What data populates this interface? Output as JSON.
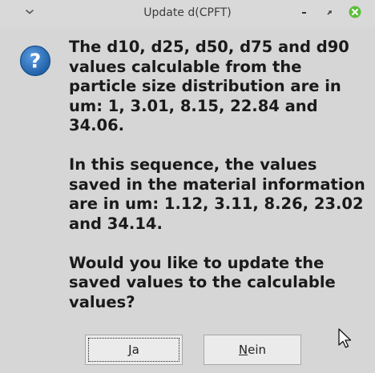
{
  "window": {
    "title": "Update d(CPFT)"
  },
  "titlebar_icons": {
    "menu": "chevron-down-icon",
    "minimize": "minimize-icon",
    "maximize": "maximize-icon",
    "close": "close-icon",
    "close_color": "#5fbe3c"
  },
  "dialog": {
    "icon": "question-icon",
    "icon_color": "#2f6fb2",
    "paragraphs": [
      "The d10, d25, d50, d75 and d90 values calculable from the particle size distribution are in um: 1, 3.01, 8.15, 22.84 and 34.06.",
      "In this sequence, the values saved in the material information are in um: 1.12, 3.11, 8.26, 23.02 and 34.14.",
      "Would you like to update the saved values to the calculable values?"
    ]
  },
  "buttons": {
    "yes": {
      "mnemonic": "J",
      "rest": "a"
    },
    "no": {
      "mnemonic": "N",
      "rest": "ein"
    }
  }
}
